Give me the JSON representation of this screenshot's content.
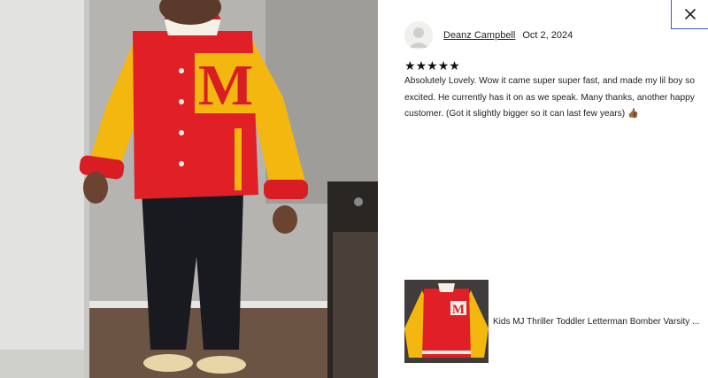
{
  "review": {
    "reviewer_name": "Deanz Campbell",
    "date": "Oct 2, 2024",
    "rating": 5,
    "stars": [
      "★",
      "★",
      "★",
      "★",
      "★"
    ],
    "text": "Absolutely Lovely. Wow it came super super fast, and made my lil boy so excited. He currently has it on as we speak. Many thanks, another happy customer. (Got it slightly bigger so it can last few years) 👍🏾"
  },
  "product": {
    "title": "Kids MJ Thriller Toddler Letterman Bomber Varsity ..."
  },
  "photo": {
    "jacket_letter": "M"
  },
  "icons": {
    "close": "close-icon",
    "avatar": "avatar-icon"
  },
  "colors": {
    "jacket_red": "#e01f26",
    "sleeve_yellow": "#f3b70f",
    "close_border": "#3a5fbf"
  }
}
